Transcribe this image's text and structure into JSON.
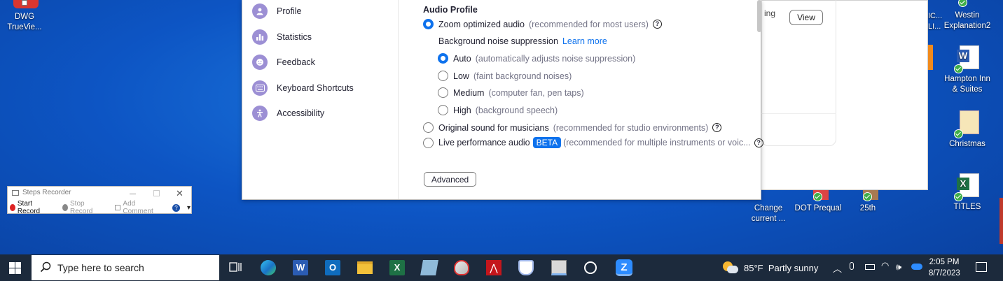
{
  "desktop": {
    "left_icons": [
      {
        "label": "DWG\nTrueVie..."
      }
    ],
    "right_icons": [
      {
        "label": "Westin\nExplanation2"
      },
      {
        "label": "Hampton Inn\n& Suites"
      },
      {
        "label": "Christmas"
      },
      {
        "label": "TITLES"
      }
    ],
    "bottom_icons": [
      {
        "label": "Change\ncurrent ..."
      },
      {
        "label": "DOT Prequal"
      },
      {
        "label": "25th"
      }
    ],
    "partial_right_text": "IC...\nLI..."
  },
  "background_window": {
    "partial_text": "ing",
    "view_button": "View"
  },
  "zoom_settings": {
    "sidebar": [
      {
        "label": "Profile",
        "icon": "profile-icon"
      },
      {
        "label": "Statistics",
        "icon": "statistics-icon"
      },
      {
        "label": "Feedback",
        "icon": "feedback-icon"
      },
      {
        "label": "Keyboard Shortcuts",
        "icon": "keyboard-icon"
      },
      {
        "label": "Accessibility",
        "icon": "accessibility-icon"
      }
    ],
    "audio_profile": {
      "title": "Audio Profile",
      "zoom_optimized": {
        "label": "Zoom optimized audio",
        "hint": "(recommended for most users)",
        "selected": true
      },
      "noise_suppression": {
        "label": "Background noise suppression",
        "link": "Learn more"
      },
      "levels": [
        {
          "label": "Auto",
          "hint": "(automatically adjusts noise suppression)",
          "selected": true
        },
        {
          "label": "Low",
          "hint": "(faint background noises)",
          "selected": false
        },
        {
          "label": "Medium",
          "hint": "(computer fan, pen taps)",
          "selected": false
        },
        {
          "label": "High",
          "hint": "(background speech)",
          "selected": false
        }
      ],
      "original_sound": {
        "label": "Original sound for musicians",
        "hint": "(recommended for studio environments)",
        "selected": false
      },
      "live_performance": {
        "label": "Live performance audio",
        "badge": "BETA",
        "hint": "(recommended for multiple instruments or voic...",
        "selected": false
      },
      "advanced_button": "Advanced"
    }
  },
  "steps_recorder": {
    "title": "Steps Recorder",
    "start_record": "Start Record",
    "stop_record": "Stop Record",
    "add_comment": "Add Comment"
  },
  "taskbar": {
    "search_placeholder": "Type here to search",
    "weather": "85°F  Partly sunny",
    "time": "2:05 PM",
    "date": "8/7/2023"
  },
  "colors": {
    "accent": "#0e72ed",
    "sidebar_icon": "#9c8fd4",
    "taskbar": "#1c2a3c"
  }
}
